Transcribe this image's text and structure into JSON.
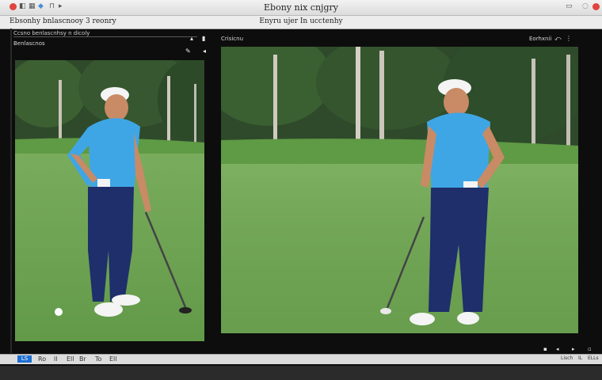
{
  "window": {
    "title": "Ebony nix cnjgry",
    "subtitle": "Enyru ujer In ucctenhy"
  },
  "toolbar": {
    "left_label": "Ebsonhy bnlascnooy 3 reonry",
    "left_sub": "Ccsno benlascnhsy n dicoly",
    "panel_a_label": "Benlascnos",
    "panel_b_label": "Crisicnu",
    "panel_b_right": "Eorhxnii"
  },
  "statusbar": {
    "tag": "LS",
    "items": [
      "Ro",
      "ll",
      "Ell",
      "Br",
      "To",
      "Ell"
    ],
    "right_items": [
      "Lisch",
      "IL",
      "ELLs"
    ]
  },
  "colors": {
    "sky_green_dark": "#2f4a2b",
    "grass": "#6fa454",
    "shirt_blue": "#3fa6e6",
    "pants_navy": "#1e2f6b"
  },
  "icons": [
    "close-icon",
    "minimize-icon",
    "zoom-icon",
    "share-icon",
    "grid-icon",
    "expand-icon",
    "crop-icon",
    "play-icon",
    "prev-icon",
    "next-icon"
  ]
}
